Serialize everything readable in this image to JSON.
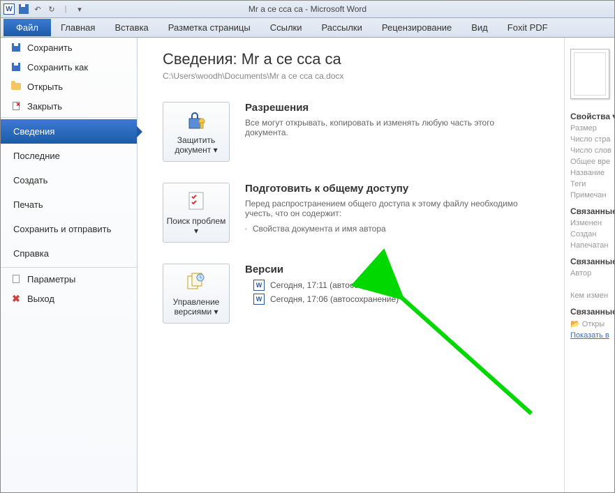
{
  "window": {
    "title": "Mr а се  сса са  -  Microsoft Word",
    "app_initial": "W"
  },
  "tabs": {
    "file": "Файл",
    "items": [
      "Главная",
      "Вставка",
      "Разметка страницы",
      "Ссылки",
      "Рассылки",
      "Рецензирование",
      "Вид",
      "Foxit PDF"
    ]
  },
  "sidebar": {
    "save": "Сохранить",
    "save_as": "Сохранить как",
    "open": "Открыть",
    "close": "Закрыть",
    "info": "Сведения",
    "recent": "Последние",
    "new": "Создать",
    "print": "Печать",
    "share": "Сохранить и отправить",
    "help": "Справка",
    "options": "Параметры",
    "exit": "Выход"
  },
  "main": {
    "heading": "Сведения: Mr а се  сса са",
    "path": "C:\\Users\\woodh\\Documents\\Mr а се  сса са.docx",
    "perm": {
      "btn": "Защитить документ ▾",
      "title": "Разрешения",
      "text": "Все могут открывать, копировать и изменять любую часть этого документа."
    },
    "prep": {
      "btn": "Поиск проблем ▾",
      "title": "Подготовить к общему доступу",
      "text": "Перед распространением общего доступа к этому файлу необходимо учесть, что он содержит:",
      "bullet": "Свойства документа и имя автора"
    },
    "vers": {
      "btn": "Управление версиями ▾",
      "title": "Версии",
      "items": [
        "Сегодня, 17:11 (автосохранение)",
        "Сегодня, 17:06 (автосохранение)"
      ]
    }
  },
  "props": {
    "head1": "Свойства ▾",
    "size": "Размер",
    "pages": "Число стра",
    "words": "Число слов",
    "time": "Общее вре",
    "name": "Название",
    "tags": "Теги",
    "notes": "Примечан",
    "head2": "Связанные",
    "changed": "Изменен",
    "created": "Создан",
    "printed": "Напечатан",
    "head3": "Связанные",
    "author": "Автор",
    "who": "Кем измен",
    "head4": "Связанные",
    "openloc": "Откры",
    "showall": "Показать в"
  }
}
